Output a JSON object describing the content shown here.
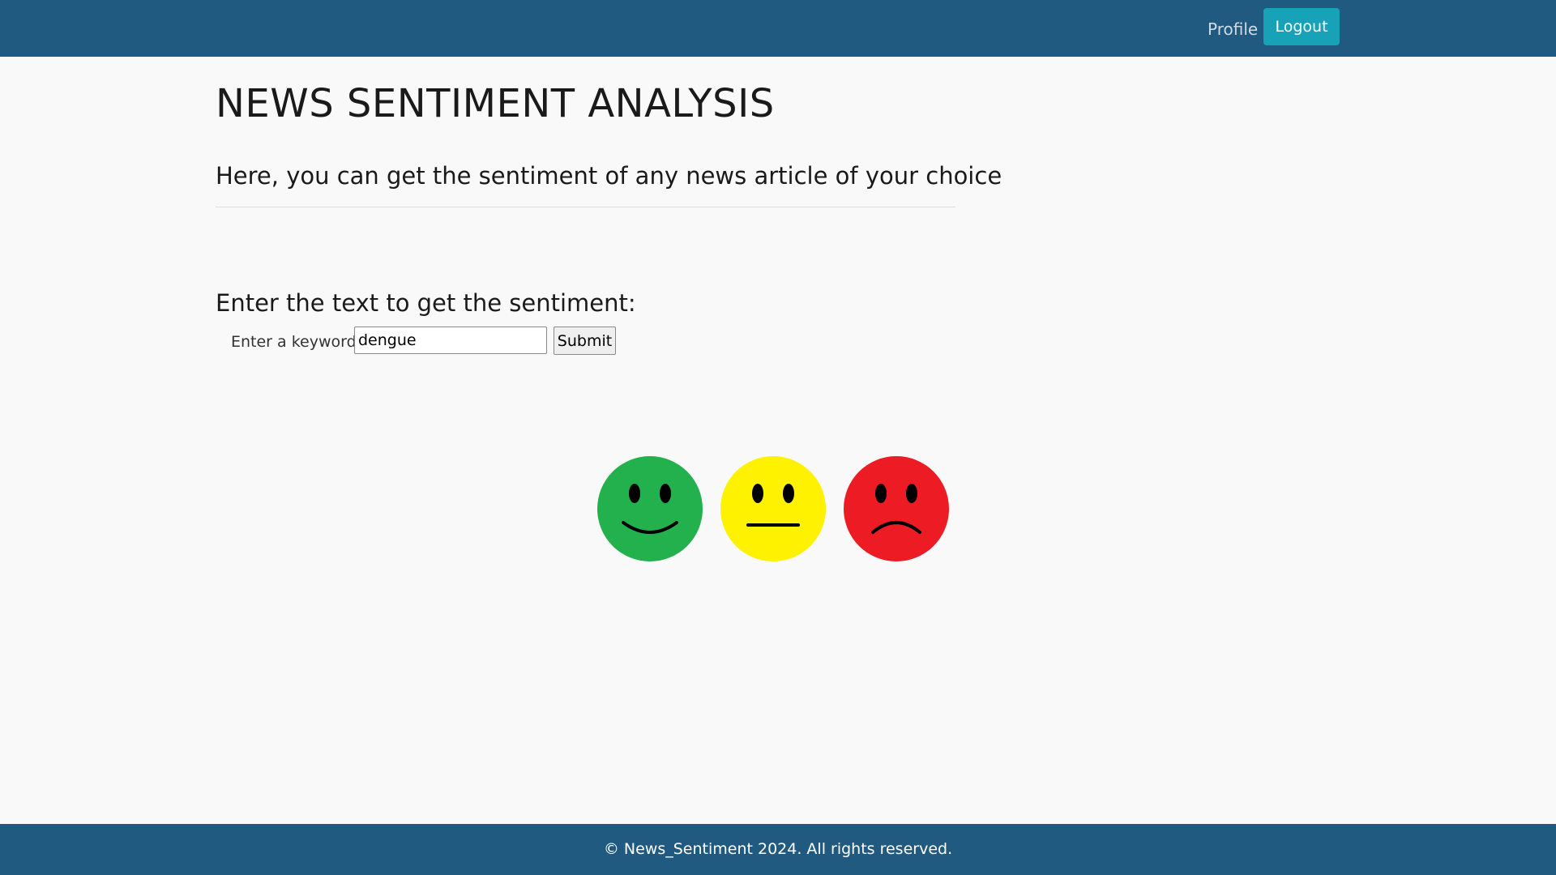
{
  "nav": {
    "profile_label": "Profile",
    "logout_label": "Logout"
  },
  "header": {
    "title": "NEWS SENTIMENT ANALYSIS",
    "subtitle": "Here, you can get the sentiment of any news article of your choice"
  },
  "form": {
    "heading": "Enter the text to get the sentiment:",
    "keyword_label": "Enter a keyword:",
    "keyword_value": "dengue",
    "submit_label": "Submit"
  },
  "sentiments": [
    {
      "icon": "happy-face-icon",
      "color": "#22b14c"
    },
    {
      "icon": "neutral-face-icon",
      "color": "#fff200"
    },
    {
      "icon": "sad-face-icon",
      "color": "#ed1c24"
    }
  ],
  "footer": {
    "text": "© News_Sentiment 2024. All rights reserved."
  },
  "colors": {
    "navbar": "#215a80",
    "logout_button": "#17a2b8",
    "background": "#f9f9f9"
  }
}
